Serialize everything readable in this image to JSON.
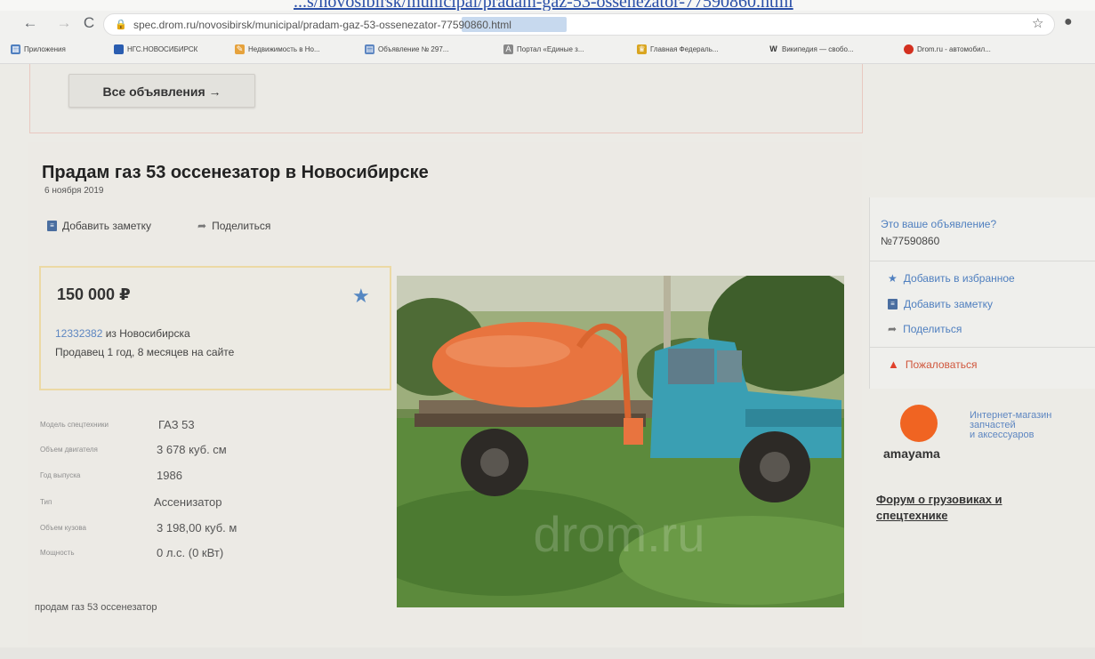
{
  "browser": {
    "top_link": "...s/novosibirsk/municipal/pradam-gaz-53-ossenezator-77590860.html",
    "url": "spec.drom.ru/novosibirsk/municipal/pradam-gaz-53-ossenezator-77590860.html",
    "nav_back": "←",
    "nav_forward": "→",
    "nav_reload": "C",
    "bookmarks": [
      "Приложения",
      "НГС.НОВОСИБИРСК",
      "Недвижимость в Но...",
      "Объявление № 297...",
      "Портал «Единые з...",
      "Главная Федераль...",
      "Википедия — свобо...",
      "Drom.ru - автомобил..."
    ]
  },
  "top": {
    "all_ads_button": "Все объявления →"
  },
  "listing": {
    "title": "Прадам газ 53 оссенезатор в Новосибирске",
    "date": "6 ноября 2019",
    "add_note": "Добавить заметку",
    "share": "Поделиться",
    "price": "150 000 ₽",
    "seller_id": "12332382",
    "seller_city": " из Новосибирска",
    "seller_age": "Продавец 1 год, 8 месяцев на сайте",
    "specs": [
      {
        "label": "Модель спецтехники",
        "value": "ГАЗ 53"
      },
      {
        "label": "Объем двигателя",
        "value": "3 678 куб. см"
      },
      {
        "label": "Год выпуска",
        "value": "1986"
      },
      {
        "label": "Тип",
        "value": "Ассенизатор"
      },
      {
        "label": "Объем кузова",
        "value": "3 198,00 куб. м"
      },
      {
        "label": "Мощность",
        "value": "0 л.с. (0 кВт)"
      }
    ],
    "description": "продам газ 53 оссенезатор",
    "watermark": "drom.ru"
  },
  "sidebar": {
    "own_ad_question": "Это ваше объявление?",
    "ad_number": "№77590860",
    "add_favorite": "Добавить в избранное",
    "add_note": "Добавить заметку",
    "share": "Поделиться",
    "report": "Пожаловаться",
    "amayama_name": "amayama",
    "amayama_line1": "Интернет-магазин",
    "amayama_line2": "запчастей",
    "amayama_line3": "и аксессуаров",
    "forum_line1": "Форум о грузовиках и",
    "forum_line2": "спецтехнике"
  },
  "colors": {
    "link_blue": "#4f7fbf",
    "report_red": "#d0563c",
    "price_border": "#ecd9a4",
    "amayama_orange": "#f06422",
    "tank_orange": "#e8743f",
    "cab_teal": "#3a9fb3"
  }
}
